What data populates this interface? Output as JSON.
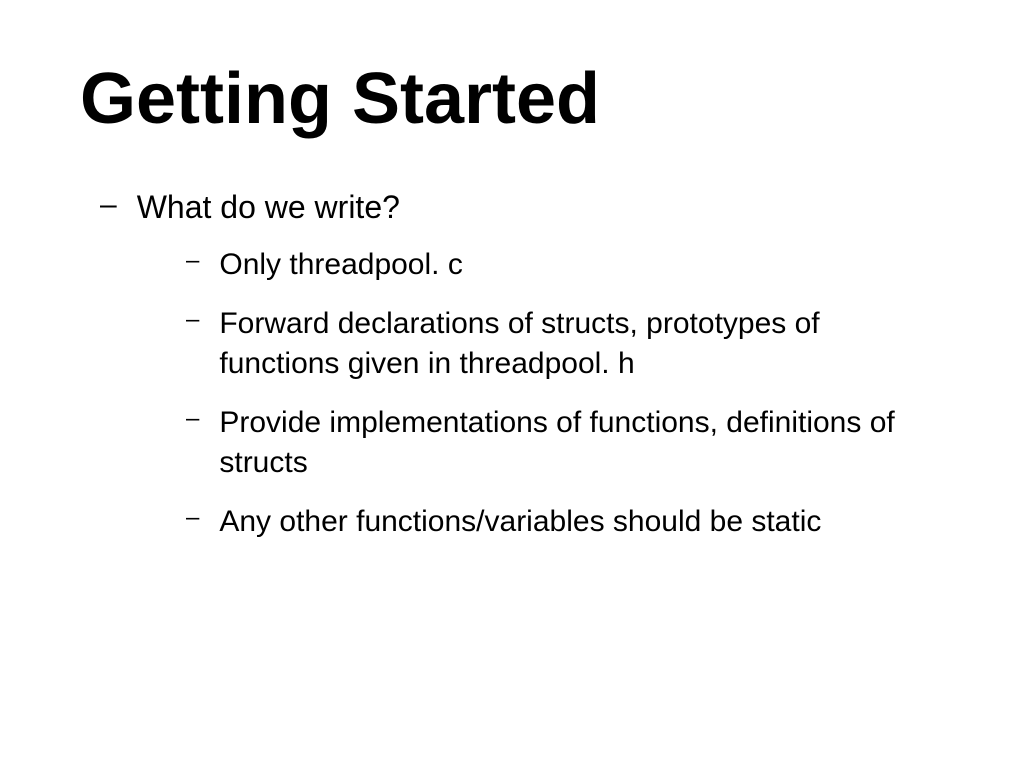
{
  "title": "Getting Started",
  "level1": {
    "item1": "What do we write?"
  },
  "level2": {
    "item1": "Only threadpool. c",
    "item2": "Forward declarations of structs, prototypes of functions given in threadpool. h",
    "item3": "Provide implementations of functions, definitions of structs",
    "item4": "Any other functions/variables should be static"
  },
  "dash": "–"
}
